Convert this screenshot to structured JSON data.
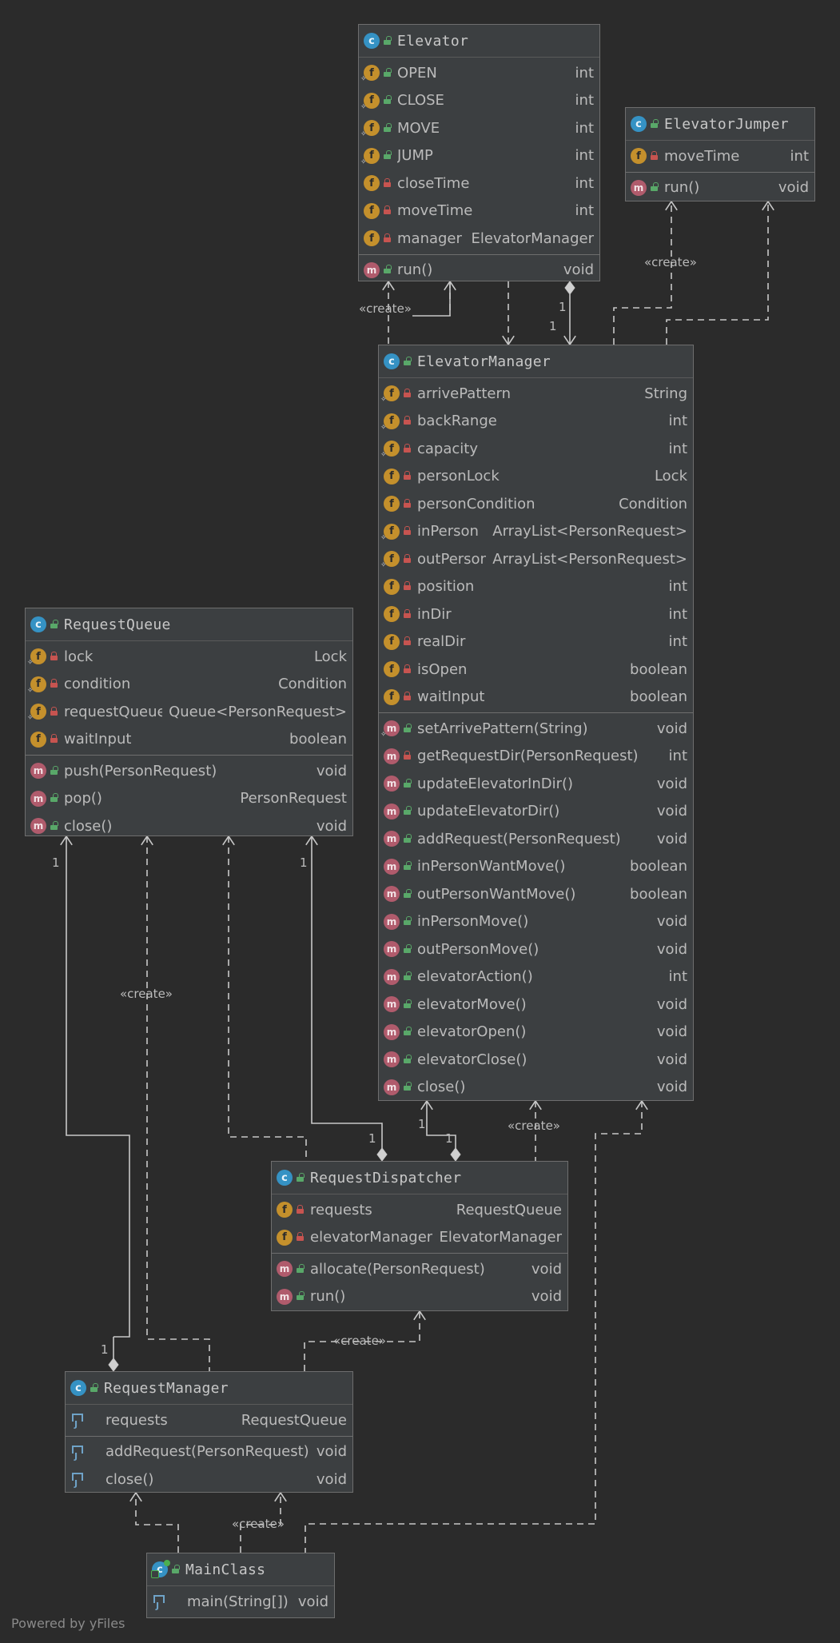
{
  "classes": {
    "elevator": {
      "name": "Elevator",
      "icon": "class-icon",
      "fields": [
        {
          "name": "OPEN",
          "type": "int",
          "vis": "public",
          "static": true
        },
        {
          "name": "CLOSE",
          "type": "int",
          "vis": "public",
          "static": true
        },
        {
          "name": "MOVE",
          "type": "int",
          "vis": "public",
          "static": true
        },
        {
          "name": "JUMP",
          "type": "int",
          "vis": "public",
          "static": true
        },
        {
          "name": "closeTime",
          "type": "int",
          "vis": "private",
          "static": false
        },
        {
          "name": "moveTime",
          "type": "int",
          "vis": "private",
          "static": false
        },
        {
          "name": "manager",
          "type": "ElevatorManager",
          "vis": "private",
          "static": false
        }
      ],
      "methods": [
        {
          "name": "run()",
          "type": "void",
          "vis": "public"
        }
      ]
    },
    "elevator_jumper": {
      "name": "ElevatorJumper",
      "icon": "class-icon",
      "fields": [
        {
          "name": "moveTime",
          "type": "int",
          "vis": "private",
          "static": false
        }
      ],
      "methods": [
        {
          "name": "run()",
          "type": "void",
          "vis": "public"
        }
      ]
    },
    "elevator_manager": {
      "name": "ElevatorManager",
      "icon": "class-icon",
      "fields": [
        {
          "name": "arrivePattern",
          "type": "String",
          "vis": "private",
          "static": true
        },
        {
          "name": "backRange",
          "type": "int",
          "vis": "private",
          "static": true
        },
        {
          "name": "capacity",
          "type": "int",
          "vis": "private",
          "static": true
        },
        {
          "name": "personLock",
          "type": "Lock",
          "vis": "private",
          "static": false
        },
        {
          "name": "personCondition",
          "type": "Condition",
          "vis": "private",
          "static": false
        },
        {
          "name": "inPerson",
          "type": "ArrayList<PersonRequest>",
          "vis": "private",
          "static": true
        },
        {
          "name": "outPerson",
          "type": "ArrayList<PersonRequest>",
          "vis": "private",
          "static": true
        },
        {
          "name": "position",
          "type": "int",
          "vis": "private",
          "static": false
        },
        {
          "name": "inDir",
          "type": "int",
          "vis": "private",
          "static": false
        },
        {
          "name": "realDir",
          "type": "int",
          "vis": "private",
          "static": false
        },
        {
          "name": "isOpen",
          "type": "boolean",
          "vis": "private",
          "static": false
        },
        {
          "name": "waitInput",
          "type": "boolean",
          "vis": "private",
          "static": false
        }
      ],
      "methods": [
        {
          "name": "setArrivePattern(String)",
          "type": "void",
          "vis": "public",
          "static": true
        },
        {
          "name": "getRequestDir(PersonRequest)",
          "type": "int",
          "vis": "private",
          "static": false
        },
        {
          "name": "updateElevatorInDir()",
          "type": "void",
          "vis": "public",
          "static": false
        },
        {
          "name": "updateElevatorDir()",
          "type": "void",
          "vis": "public",
          "static": false
        },
        {
          "name": "addRequest(PersonRequest)",
          "type": "void",
          "vis": "public",
          "static": false
        },
        {
          "name": "inPersonWantMove()",
          "type": "boolean",
          "vis": "public",
          "static": false
        },
        {
          "name": "outPersonWantMove()",
          "type": "boolean",
          "vis": "public",
          "static": false
        },
        {
          "name": "inPersonMove()",
          "type": "void",
          "vis": "public",
          "static": false
        },
        {
          "name": "outPersonMove()",
          "type": "void",
          "vis": "public",
          "static": false
        },
        {
          "name": "elevatorAction()",
          "type": "int",
          "vis": "public",
          "static": false
        },
        {
          "name": "elevatorMove()",
          "type": "void",
          "vis": "public",
          "static": false
        },
        {
          "name": "elevatorOpen()",
          "type": "void",
          "vis": "public",
          "static": false
        },
        {
          "name": "elevatorClose()",
          "type": "void",
          "vis": "public",
          "static": false
        },
        {
          "name": "close()",
          "type": "void",
          "vis": "public",
          "static": false
        }
      ]
    },
    "request_queue": {
      "name": "RequestQueue",
      "icon": "class-icon",
      "fields": [
        {
          "name": "lock",
          "type": "Lock",
          "vis": "private",
          "static": true
        },
        {
          "name": "condition",
          "type": "Condition",
          "vis": "private",
          "static": true
        },
        {
          "name": "requestQueue",
          "type": "Queue<PersonRequest>",
          "vis": "private",
          "static": true
        },
        {
          "name": "waitInput",
          "type": "boolean",
          "vis": "private",
          "static": false
        }
      ],
      "methods": [
        {
          "name": "push(PersonRequest)",
          "type": "void",
          "vis": "public"
        },
        {
          "name": "pop()",
          "type": "PersonRequest",
          "vis": "public"
        },
        {
          "name": "close()",
          "type": "void",
          "vis": "public"
        }
      ]
    },
    "request_dispatcher": {
      "name": "RequestDispatcher",
      "icon": "class-icon",
      "fields": [
        {
          "name": "requests",
          "type": "RequestQueue",
          "vis": "private",
          "static": false
        },
        {
          "name": "elevatorManager",
          "type": "ElevatorManager",
          "vis": "private",
          "static": false
        }
      ],
      "methods": [
        {
          "name": "allocate(PersonRequest)",
          "type": "void",
          "vis": "public"
        },
        {
          "name": "run()",
          "type": "void",
          "vis": "public"
        }
      ]
    },
    "request_manager": {
      "name": "RequestManager",
      "icon": "class-icon",
      "fields": [
        {
          "name": "requests",
          "type": "RequestQueue",
          "vis": "package"
        }
      ],
      "methods": [
        {
          "name": "addRequest(PersonRequest)",
          "type": "void",
          "vis": "package"
        },
        {
          "name": "close()",
          "type": "void",
          "vis": "package"
        }
      ]
    },
    "main_class": {
      "name": "MainClass",
      "icon": "main-class-icon",
      "fields": [],
      "methods": [
        {
          "name": "main(String[])",
          "type": "void",
          "vis": "package"
        }
      ]
    }
  },
  "labels": {
    "create": "«create»",
    "one": "1"
  },
  "footer": "Powered by yFiles",
  "colors": {
    "background": "#2b2b2b",
    "node": "#3c3f41",
    "edge": "#c8c8c8",
    "class_icon": "#3592c4",
    "field_icon": "#c4902c",
    "method_icon": "#b05b6c",
    "public": "#59a869",
    "private": "#c75450"
  }
}
